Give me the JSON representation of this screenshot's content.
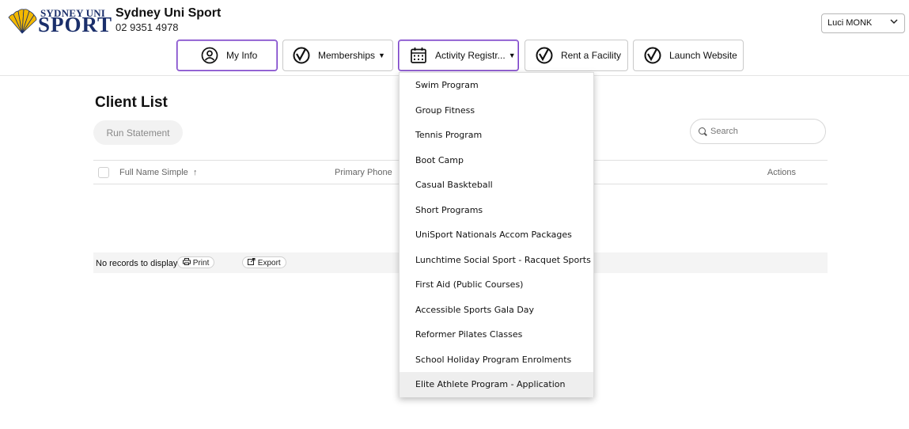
{
  "header": {
    "logo_line1": "SYDNEY UNI",
    "logo_line2": "SPORT",
    "org_name": "Sydney Uni Sport",
    "phone": "02 9351 4978",
    "user_select_value": "Luci MONK"
  },
  "nav": {
    "my_info": "My Info",
    "memberships": "Memberships",
    "activity": "Activity Registr...",
    "rent": "Rent a Facility",
    "launch": "Launch Website"
  },
  "main": {
    "title": "Client List",
    "run_statement": "Run Statement",
    "search_placeholder": "Search",
    "columns": {
      "name": "Full Name Simple",
      "sort_glyph": "↑",
      "phone": "Primary Phone",
      "actions": "Actions"
    },
    "empty_text": "No records to display",
    "print_label": "Print",
    "export_label": "Export"
  },
  "dropdown": {
    "items": [
      "Swim Program",
      "Group Fitness",
      "Tennis Program",
      "Boot Camp",
      "Casual Baskteball",
      "Short Programs",
      "UniSport Nationals Accom Packages",
      "Lunchtime Social Sport - Racquet Sports",
      "First Aid (Public Courses)",
      "Accessible Sports Gala Day",
      "Reformer Pilates Classes",
      "School Holiday Program Enrolments",
      "Elite Athlete Program - Application"
    ],
    "highlighted_item": "Elite Athlete Program - Application"
  },
  "icons": {
    "logo": "fan-logo-icon",
    "my_info": "user-circle-icon",
    "memberships": "sport-check-icon",
    "activity": "calendar-grid-icon",
    "rent": "sport-check-icon",
    "launch": "sport-check-icon",
    "dropdown_caret": "caret-down-icon",
    "user_select": "chevron-down-icon",
    "search": "search-icon",
    "print": "printer-icon",
    "export": "external-link-icon"
  },
  "colors": {
    "brand_navy": "#1b2f6b",
    "logo_gold": "#f2b800",
    "active_border": "#7a3fc8",
    "highlight_row": "#eeeeee"
  }
}
